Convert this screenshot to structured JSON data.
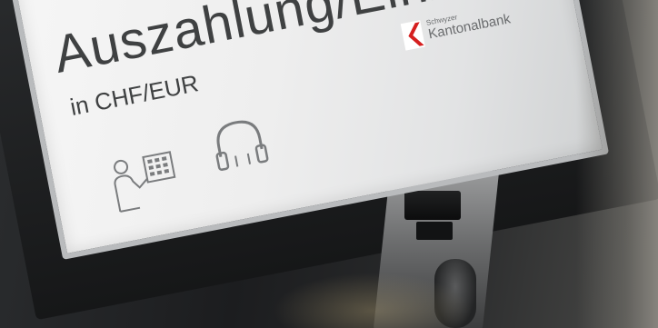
{
  "sign": {
    "title": "Auszahlung/Einzahlung",
    "subtitle": "in CHF/EUR"
  },
  "bank": {
    "small_text": "Schwyzer",
    "name": "Kantonalbank",
    "brand_color": "#d51f1f"
  },
  "icons": {
    "person": "person-at-keypad-icon",
    "headphones": "headphones-icon"
  }
}
